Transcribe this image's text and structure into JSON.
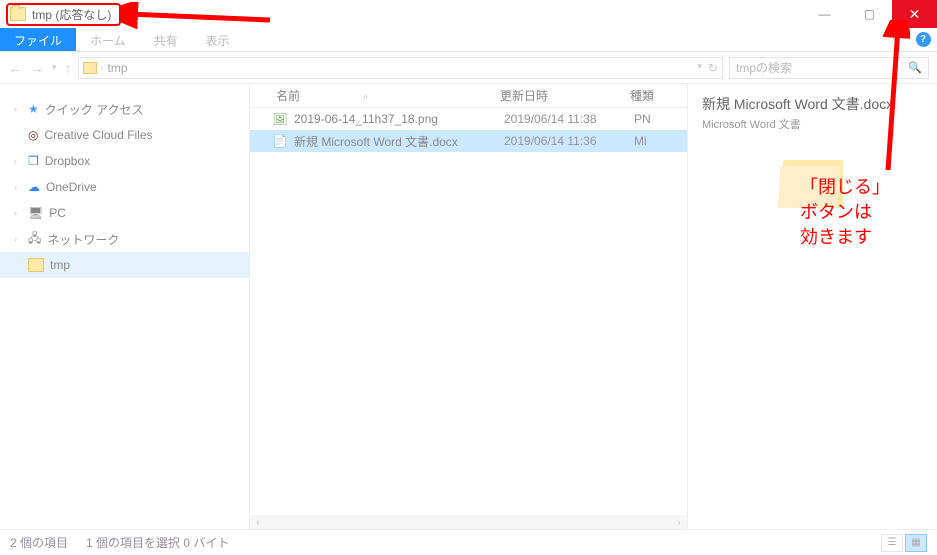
{
  "window": {
    "title": "tmp (応答なし)",
    "minimize_symbol": "—",
    "maximize_symbol": "▢",
    "close_symbol": "✕"
  },
  "ribbon": {
    "file": "ファイル",
    "home": "ホーム",
    "share": "共有",
    "view": "表示",
    "expand_symbol": "v",
    "help_symbol": "?"
  },
  "nav": {
    "back": "←",
    "forward": "→",
    "dropdown": "▾",
    "up": "↑",
    "refresh": "↻",
    "dropdown2": "▾"
  },
  "address": {
    "segment": "tmp",
    "chevron": "›"
  },
  "search": {
    "placeholder": "tmpの検索",
    "icon": "🔍"
  },
  "tree": {
    "quick_access": "クイック アクセス",
    "creative_cloud": "Creative Cloud Files",
    "dropbox": "Dropbox",
    "onedrive": "OneDrive",
    "pc": "PC",
    "network": "ネットワーク",
    "tmp": "tmp"
  },
  "columns": {
    "name": "名前",
    "modified": "更新日時",
    "type": "種類"
  },
  "files": [
    {
      "icon": "🖼",
      "name": "2019-06-14_11h37_18.png",
      "date": "2019/06/14 11:38",
      "type": "PN"
    },
    {
      "icon": "📄",
      "name": "新規 Microsoft Word 文書.docx",
      "date": "2019/06/14 11:36",
      "type": "Mi"
    }
  ],
  "details": {
    "title": "新規 Microsoft Word 文書.docx",
    "type": "Microsoft Word 文書"
  },
  "status": {
    "count": "2 個の項目",
    "selection": "1 個の項目を選択 0 バイト"
  },
  "annotations": {
    "close_note": "「閉じる」\nボタンは\n効きます"
  }
}
